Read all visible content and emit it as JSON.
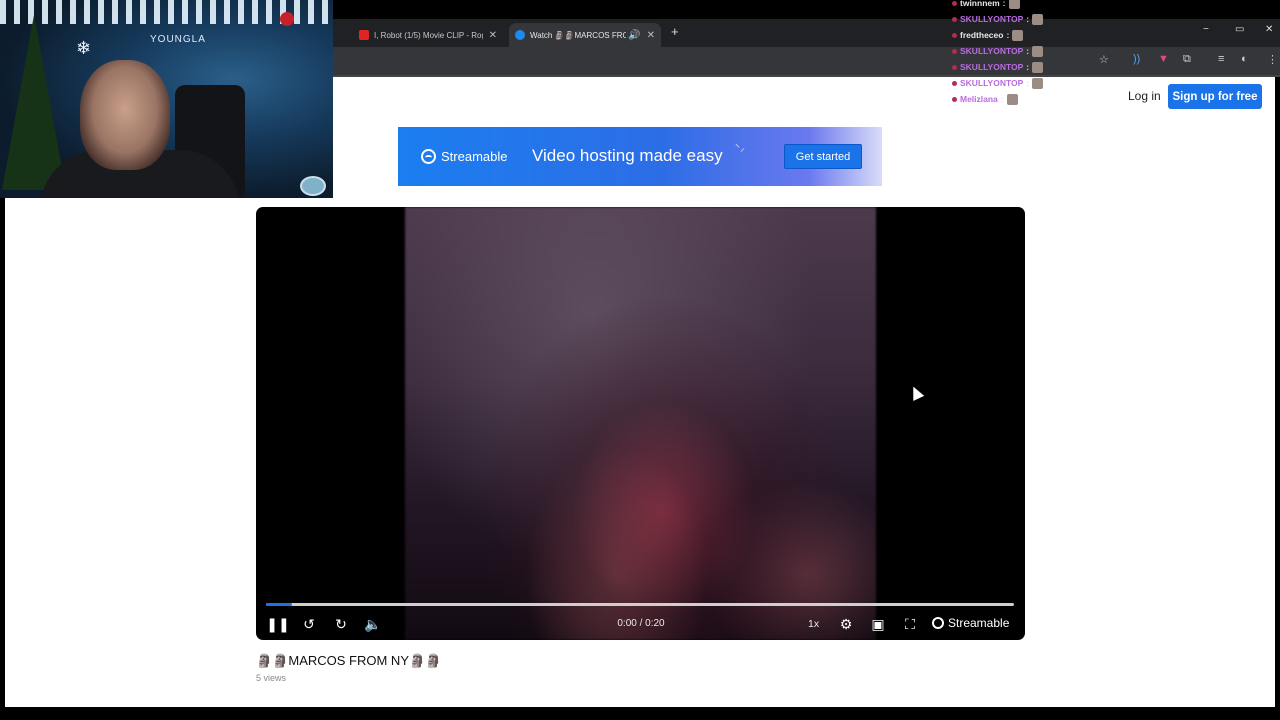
{
  "browser": {
    "tabs": [
      {
        "title": "I, Robot (1/5) Movie CLIP - Rog",
        "favicon": "youtube-icon",
        "active": false
      },
      {
        "title": "Watch 🗿🗿MARCOS FROM",
        "favicon": "streamable-icon",
        "active": true
      }
    ],
    "new_tab": "+",
    "window_controls": [
      "−",
      "▭",
      "✕"
    ]
  },
  "header": {
    "login": "Log in",
    "signup": "Sign up for free"
  },
  "banner": {
    "brand": "Streamable",
    "tagline": "Video hosting made easy",
    "cta": "Get started"
  },
  "player": {
    "time": "0:00 / 0:20",
    "progress_fraction": 0.035,
    "speed": "1x",
    "brand": "Streamable"
  },
  "video": {
    "title": "🗿🗿MARCOS FROM NY🗿🗿",
    "views": "5 views"
  },
  "stream_overlay": {
    "wall_logo": "YOUNGLA"
  },
  "chat": [
    {
      "name": "twinnnem",
      "color": "white"
    },
    {
      "name": "SKULLYONTOP",
      "color": "purple"
    },
    {
      "name": "fredtheceo",
      "color": "white"
    },
    {
      "name": "SKULLYONTOP",
      "color": "purple"
    },
    {
      "name": "SKULLYONTOP",
      "color": "purple"
    },
    {
      "name": "SKULLYONTOP",
      "color": "purple"
    },
    {
      "name": "Melizlana",
      "color": "purple"
    }
  ],
  "colors": {
    "accent": "#1a73e8",
    "chrome_dark": "#202124",
    "chat_name": "#b86ce0"
  }
}
